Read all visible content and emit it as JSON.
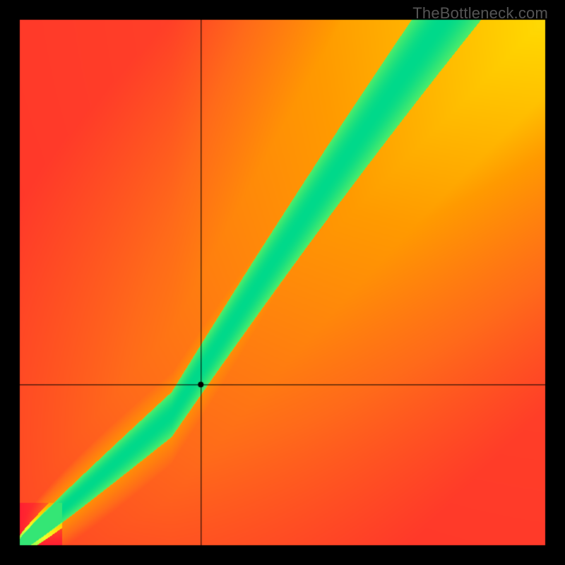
{
  "watermark_text": "TheBottleneck.com",
  "chart_data": {
    "type": "heatmap",
    "title": "",
    "xlabel": "",
    "ylabel": "",
    "xlim": [
      0,
      100
    ],
    "ylim": [
      0,
      100
    ],
    "resolution": 128,
    "border_px": 28,
    "marker": {
      "x": 34.5,
      "y": 30.5,
      "radius": 4
    },
    "crosshair": {
      "x": 34.5,
      "y": 30.5
    },
    "ridge": {
      "lower_breakpoint": {
        "x": 29,
        "y": 25
      },
      "upper_start_slope": 1.54,
      "lower_start_slope": 0.86,
      "band_halfwidth_at_break": 4,
      "band_halfwidth_at_top": 10
    },
    "colorscale": [
      {
        "t": 0.0,
        "color": "#ff1a33"
      },
      {
        "t": 0.28,
        "color": "#ff6a1a"
      },
      {
        "t": 0.5,
        "color": "#ff9a00"
      },
      {
        "t": 0.68,
        "color": "#ffd400"
      },
      {
        "t": 0.82,
        "color": "#f6ff2a"
      },
      {
        "t": 0.91,
        "color": "#9bff4a"
      },
      {
        "t": 1.0,
        "color": "#00d98a"
      }
    ]
  }
}
